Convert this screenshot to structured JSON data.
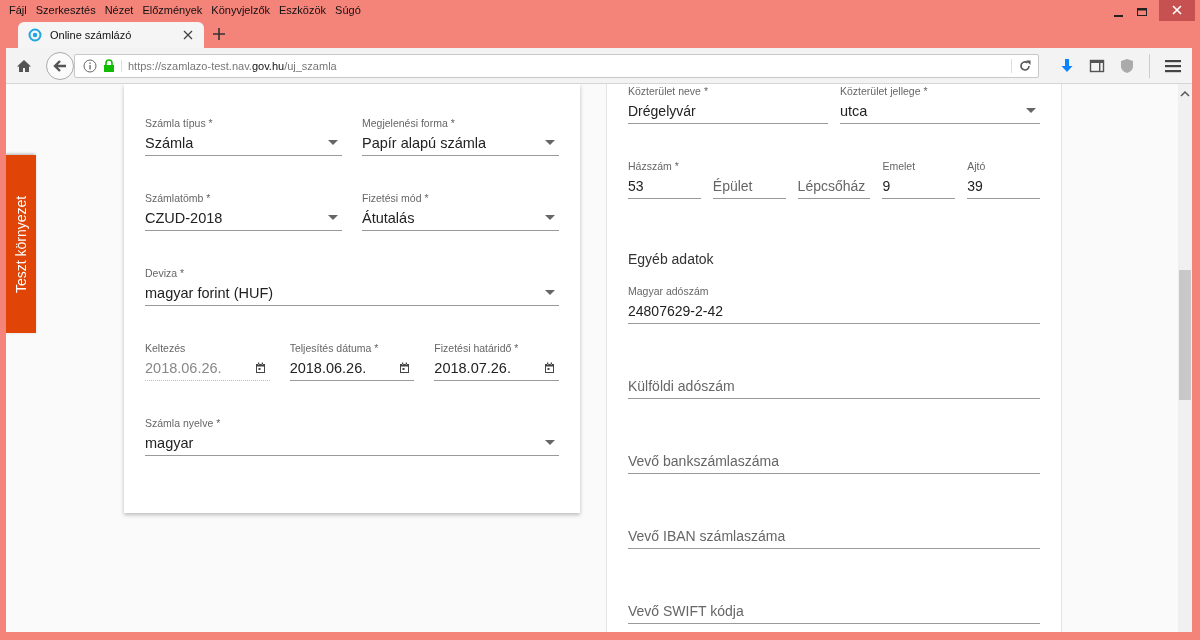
{
  "menu": [
    "Fájl",
    "Szerkesztés",
    "Nézet",
    "Előzmények",
    "Könyvjelzők",
    "Eszközök",
    "Súgó"
  ],
  "tabs": [
    {
      "title": "Online számlázó",
      "selected": true
    }
  ],
  "address_bar": {
    "url": "https://szamlazo-test.nav.**gov.hu**/uj_szamla"
  },
  "side_tab": {
    "label": "Teszt környezet"
  },
  "left_card": {
    "items": [
      {
        "kind": "row",
        "fields": [
          {
            "kind": "select",
            "label": "Számla típus *",
            "value": "Számla"
          },
          {
            "kind": "select",
            "label": "Megjelenési forma *",
            "value": "Papír alapú számla"
          }
        ]
      },
      {
        "kind": "row",
        "fields": [
          {
            "kind": "select",
            "label": "Számlatömb *",
            "value": "CZUD-2018"
          },
          {
            "kind": "select",
            "label": "Fizetési mód *",
            "value": "Átutalás"
          }
        ]
      },
      {
        "kind": "row",
        "fields": [
          {
            "kind": "select",
            "label": "Deviza *",
            "value": "magyar forint (HUF)"
          }
        ]
      },
      {
        "kind": "row",
        "fields": [
          {
            "kind": "date",
            "label": "Keltezés",
            "value": "2018.06.26.",
            "disabled": true
          },
          {
            "kind": "date",
            "label": "Teljesítés dátuma  *",
            "value": "2018.06.26.",
            "disabled": false
          },
          {
            "kind": "date",
            "label": "Fizetési határidő  *",
            "value": "2018.07.26.",
            "disabled": false
          }
        ]
      },
      {
        "kind": "row",
        "fields": [
          {
            "kind": "select",
            "label": "Számla nyelve *",
            "value": "magyar"
          }
        ]
      }
    ]
  },
  "right_card": {
    "items": [
      {
        "kind": "row",
        "fields": [
          {
            "kind": "text",
            "label": "Közterület neve *",
            "value": "Drégelyvár"
          },
          {
            "kind": "select",
            "label": "Közterület jellege *",
            "value": "utca"
          }
        ]
      },
      {
        "kind": "row",
        "fields": [
          {
            "kind": "text",
            "label": "Házszám *",
            "value": "53"
          },
          {
            "kind": "text",
            "placeholder": "Épület"
          },
          {
            "kind": "text",
            "placeholder": "Lépcsőház"
          },
          {
            "kind": "text",
            "label": "Emelet",
            "value": "9"
          },
          {
            "kind": "text",
            "label": "Ajtó",
            "value": "39"
          }
        ]
      },
      {
        "kind": "heading",
        "text": "Egyéb adatok"
      },
      {
        "kind": "row",
        "fields": [
          {
            "kind": "text",
            "label": "Magyar adószám",
            "value": "24807629-2-42"
          }
        ]
      },
      {
        "kind": "row",
        "fields": [
          {
            "kind": "text",
            "placeholder": "Külföldi adószám"
          }
        ]
      },
      {
        "kind": "row",
        "fields": [
          {
            "kind": "text",
            "placeholder": "Vevő bankszámlaszáma"
          }
        ]
      },
      {
        "kind": "row",
        "fields": [
          {
            "kind": "text",
            "placeholder": "Vevő IBAN számlaszáma"
          }
        ]
      },
      {
        "kind": "row",
        "fields": [
          {
            "kind": "text",
            "placeholder": "Vevő SWIFT kódja"
          }
        ]
      }
    ]
  }
}
